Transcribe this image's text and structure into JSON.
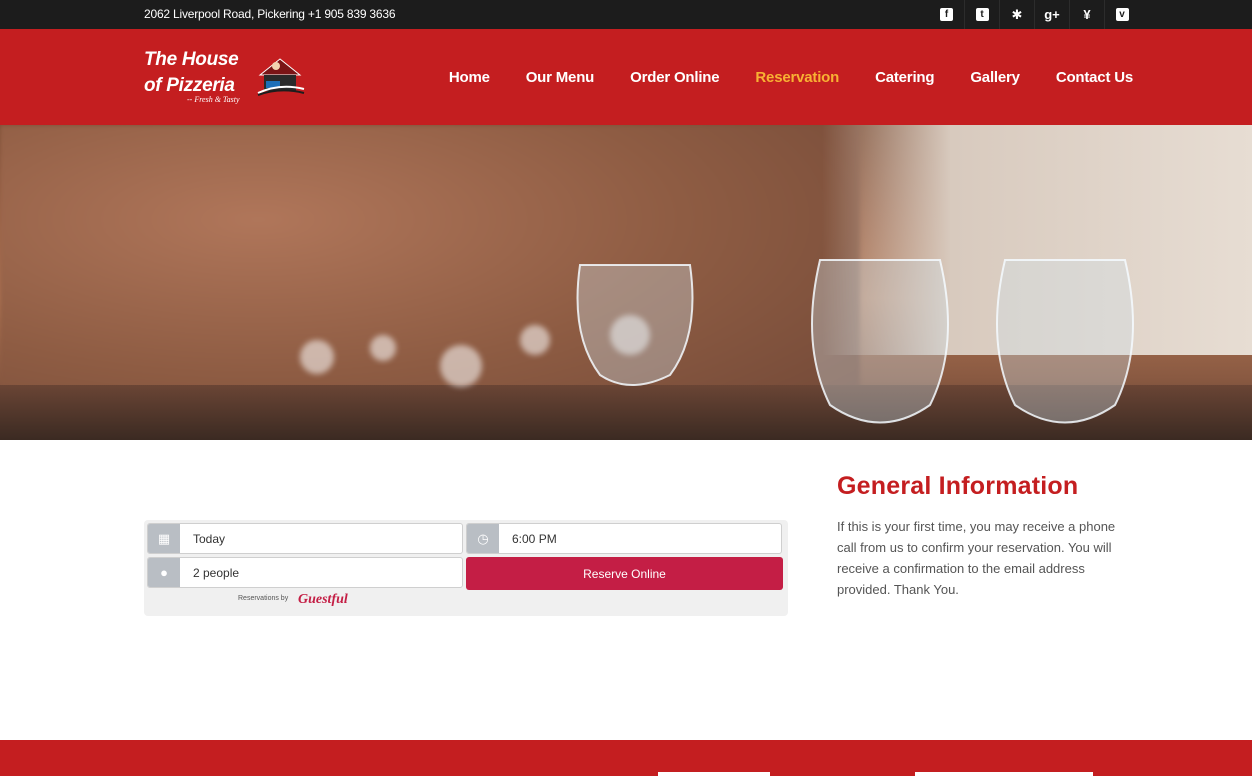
{
  "topbar": {
    "address": "2062 Liverpool Road, Pickering +1 905 839 3636",
    "social": [
      {
        "name": "facebook-icon",
        "glyph": "f"
      },
      {
        "name": "twitter-icon",
        "glyph": "t"
      },
      {
        "name": "yelp-icon",
        "glyph": "✱"
      },
      {
        "name": "google-plus-icon",
        "glyph": "g+"
      },
      {
        "name": "yen-icon",
        "glyph": "¥"
      },
      {
        "name": "pocket-icon",
        "glyph": "v"
      }
    ]
  },
  "logo": {
    "line1": "The House",
    "line2": "of Pizzeria",
    "tagline": "-- Fresh & Tasty"
  },
  "nav": {
    "items": [
      "Home",
      "Our Menu",
      "Order Online",
      "Reservation",
      "Catering",
      "Gallery",
      "Contact Us"
    ],
    "active": "Reservation"
  },
  "reservation": {
    "date": "Today",
    "time": "6:00 PM",
    "party": "2 people",
    "button": "Reserve Online",
    "powered_by": "Reservations by",
    "brand": "Guestful"
  },
  "info": {
    "title": "General Information",
    "text": "If this is your first time, you may receive a phone call from us to confirm your reservation. You will receive a confirmation to the email address provided. Thank You."
  },
  "colors": {
    "brand_red": "#c41e20",
    "active_nav": "#f8b133",
    "reserve_button": "#c41e45",
    "topbar": "#1c1c1c"
  }
}
